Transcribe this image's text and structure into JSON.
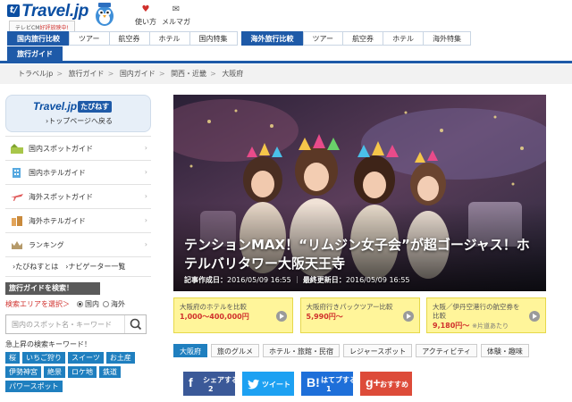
{
  "header": {
    "logo_text": "Travel.jp",
    "logo_mark": "t/",
    "tagline_prefix": "テレビCM",
    "tagline_red": "好評放映中!",
    "links": [
      {
        "label": "使い方",
        "icon": "heart-icon"
      },
      {
        "label": "メルマガ",
        "icon": "mail-icon"
      }
    ]
  },
  "nav": {
    "row1": [
      {
        "label": "国内旅行比較",
        "active": true
      },
      {
        "label": "ツアー"
      },
      {
        "label": "航空券"
      },
      {
        "label": "ホテル"
      },
      {
        "label": "国内特集"
      },
      {
        "label": "海外旅行比較",
        "active": true
      },
      {
        "label": "ツアー"
      },
      {
        "label": "航空券"
      },
      {
        "label": "ホテル"
      },
      {
        "label": "海外特集"
      }
    ],
    "row2": [
      {
        "label": "旅行ガイド",
        "active": true
      }
    ]
  },
  "breadcrumb": [
    "トラベルjp",
    "旅行ガイド",
    "国内ガイド",
    "関西・近畿",
    "大阪府"
  ],
  "sidebar": {
    "tabi_logo": "Travel.jp",
    "tabi_badge": "たびねす",
    "back_link": "›トップページへ戻る",
    "menu": [
      {
        "label": "国内スポットガイド",
        "icon": "spot-icon"
      },
      {
        "label": "国内ホテルガイド",
        "icon": "hotel-icon"
      },
      {
        "label": "海外スポットガイド",
        "icon": "airplane-icon"
      },
      {
        "label": "海外ホテルガイド",
        "icon": "overseas-hotel-icon"
      },
      {
        "label": "ランキング",
        "icon": "crown-icon"
      }
    ],
    "links": [
      "›たびねすとは",
      "›ナビゲーター一覧"
    ],
    "search_head": "旅行ガイドを検索！",
    "area_label": "検索エリアを選択＞",
    "area_options": [
      "国内",
      "海外"
    ],
    "search_placeholder": "国内のスポット名・キーワード",
    "popular_head": "急上昇の検索キーワード！",
    "keywords": [
      "桜",
      "いちご狩り",
      "スイーツ",
      "お土産",
      "伊勢神宮",
      "絶景",
      "ロケ地",
      "鉄道",
      "パワースポット"
    ]
  },
  "article": {
    "title": "テンションMAX！“リムジン女子会”が超ゴージャス！ホテルバリタワー大阪天王寺",
    "created_label": "記事作成日：",
    "created": "2016/05/09 16:55",
    "updated_label": "最終更新日：",
    "updated": "2016/05/09 16:55"
  },
  "ads": [
    {
      "line1": "大阪府のホテルを比較",
      "line2": "1,000〜400,000円",
      "note": ""
    },
    {
      "line1": "大阪府行きパックツアー比較",
      "line2": "5,990円〜",
      "note": ""
    },
    {
      "line1": "大阪／伊丹空港行の航空券を比較",
      "line2": "9,180円〜",
      "note": "※片道あたり"
    }
  ],
  "tags": [
    "大阪府",
    "旅のグルメ",
    "ホテル・旅館・民宿",
    "レジャースポット",
    "アクティビティ",
    "体験・趣味"
  ],
  "share": [
    {
      "glyph": "f",
      "label": "シェアする",
      "count": "2"
    },
    {
      "glyph": "🐦",
      "label": "ツイート",
      "count": ""
    },
    {
      "glyph": "B!",
      "label": "はてブする",
      "count": "1"
    },
    {
      "glyph": "g+",
      "label": "おすすめ",
      "count": ""
    }
  ],
  "colors": {
    "brand_blue": "#0a4ea2",
    "nav_active": "#1e5aa8",
    "keyword_blue": "#1f7fbf",
    "ad_yellow": "#fff59a",
    "ad_price_red": "#d0302c"
  }
}
